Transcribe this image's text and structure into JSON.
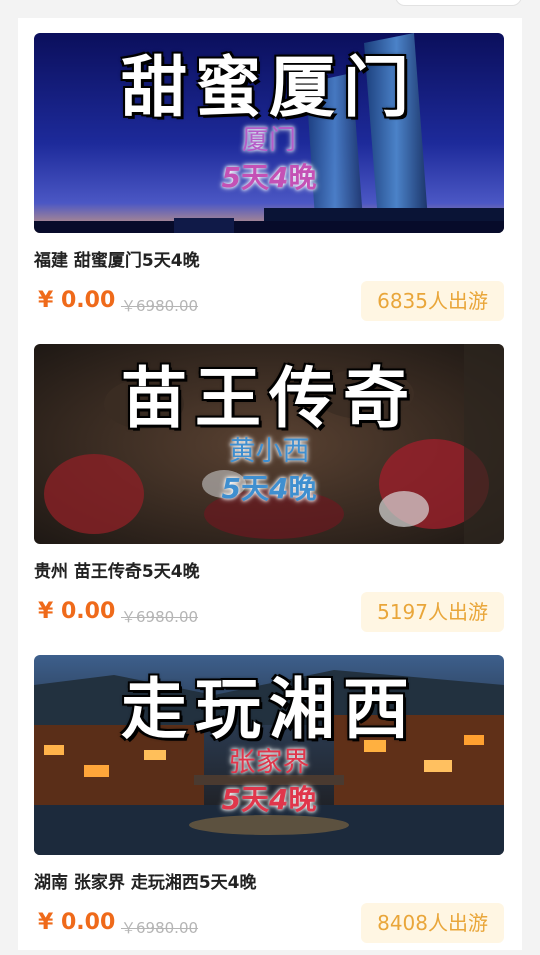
{
  "products": [
    {
      "banner": {
        "title": "甜蜜厦门",
        "subtitle": "厦门",
        "days_num1": "5",
        "days_word1": "天",
        "days_num2": "4",
        "days_word2": "晚",
        "sub_color": "#b55cc8",
        "days_color": "#c451b5"
      },
      "name": "福建 甜蜜厦门5天4晚",
      "price": "¥ 0.00",
      "original_price": "￥6980.00",
      "travelers": "6835人出游"
    },
    {
      "banner": {
        "title": "苗王传奇",
        "subtitle": "黄小西",
        "days_num1": "5",
        "days_word1": "天",
        "days_num2": "4",
        "days_word2": "晚",
        "sub_color": "#3f8fd0",
        "days_color": "#3f8fd0"
      },
      "name": "贵州 苗王传奇5天4晚",
      "price": "¥ 0.00",
      "original_price": "￥6980.00",
      "travelers": "5197人出游"
    },
    {
      "banner": {
        "title": "走玩湘西",
        "subtitle": "张家界",
        "days_num1": "5",
        "days_word1": "天",
        "days_num2": "4",
        "days_word2": "晚",
        "sub_color": "#e0364b",
        "days_color": "#e0364b"
      },
      "name": "湖南 张家界 走玩湘西5天4晚",
      "price": "¥ 0.00",
      "original_price": "￥6980.00",
      "travelers": "8408人出游"
    }
  ]
}
